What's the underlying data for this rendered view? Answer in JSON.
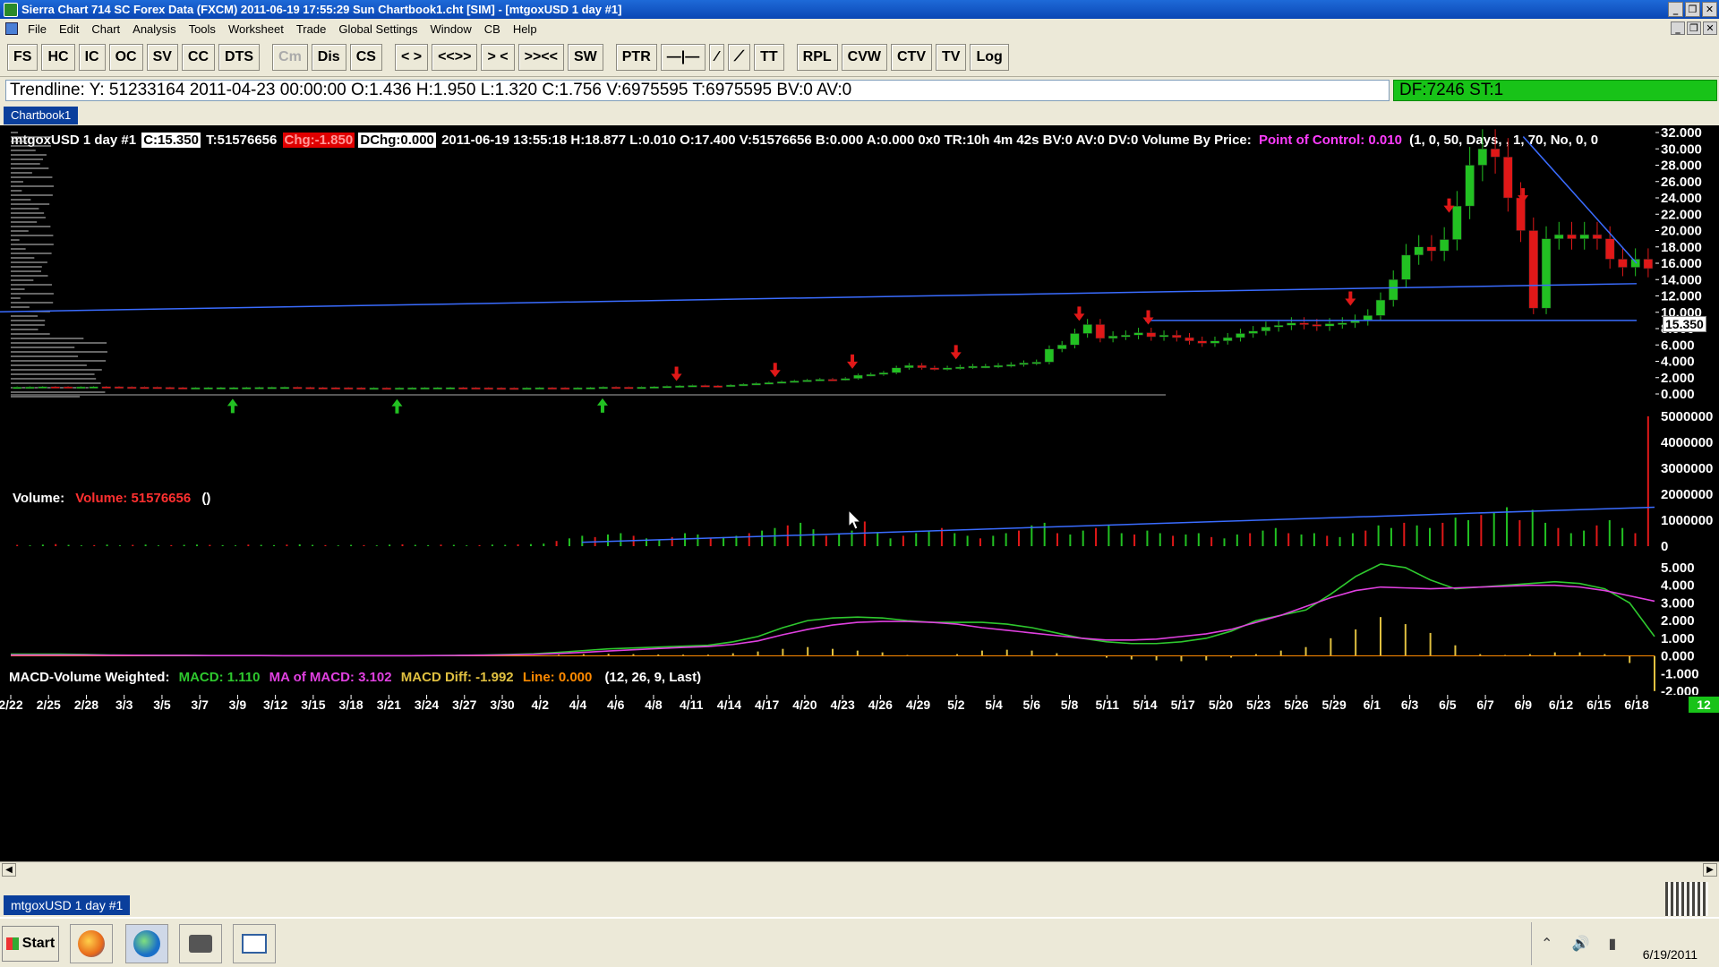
{
  "window": {
    "title": "Sierra Chart 714 SC Forex Data (FXCM) 2011-06-19  17:55:29  Sun   Chartbook1.cht [SIM] - [mtgoxUSD  1 day  #1]",
    "controls": [
      "_",
      "❐",
      "✕"
    ]
  },
  "menu": [
    "File",
    "Edit",
    "Chart",
    "Analysis",
    "Tools",
    "Worksheet",
    "Trade",
    "Global Settings",
    "Window",
    "CB",
    "Help"
  ],
  "toolbar": {
    "buttons": [
      {
        "label": "FS",
        "enabled": true
      },
      {
        "label": "HC",
        "enabled": true
      },
      {
        "label": "IC",
        "enabled": true
      },
      {
        "label": "OC",
        "enabled": true
      },
      {
        "label": "SV",
        "enabled": true
      },
      {
        "label": "CC",
        "enabled": true
      },
      {
        "label": "DTS",
        "enabled": true
      },
      {
        "label": "Cm",
        "enabled": false
      },
      {
        "label": "Dis",
        "enabled": true
      },
      {
        "label": "CS",
        "enabled": true
      },
      {
        "label": "< >",
        "enabled": true
      },
      {
        "label": "<<>>",
        "enabled": true
      },
      {
        "label": "> <",
        "enabled": true
      },
      {
        "label": ">><<",
        "enabled": true
      },
      {
        "label": "SW",
        "enabled": true
      },
      {
        "label": "PTR",
        "enabled": true
      },
      {
        "label": "—|—",
        "enabled": true
      },
      {
        "label": "⁄",
        "enabled": true
      },
      {
        "label": "⟋",
        "enabled": true
      },
      {
        "label": "TT",
        "enabled": true
      },
      {
        "label": "RPL",
        "enabled": true
      },
      {
        "label": "CVW",
        "enabled": true
      },
      {
        "label": "CTV",
        "enabled": true
      },
      {
        "label": "TV",
        "enabled": true
      },
      {
        "label": "Log",
        "enabled": true
      }
    ]
  },
  "infobar": {
    "trendline": "Trendline: Y: 51233164  2011-04-23  00:00:00  O:1.436  H:1.950  L:1.320  C:1.756  V:6975595  T:6975595  BV:0  AV:0",
    "df": "DF:7246  ST:1"
  },
  "chartbook_tab": "Chartbook1",
  "chart_header": {
    "symbol": "mtgoxUSD  1 day   #1",
    "close": "C:15.350",
    "ticks": "T:51576656",
    "chg": "Chg:-1.850",
    "dchg": "DChg:0.000",
    "detail": "2011-06-19 13:55:18 H:18.877 L:0.010 O:17.400 V:51576656 B:0.000 A:0.000 0x0 TR:10h 4m 42s BV:0 AV:0 DV:0 Volume By Price:",
    "poc": "Point of Control: 0.010",
    "params": "(1, 0, 50, Days, , 1, 70, No, 0, 0"
  },
  "price_tag": "15.350",
  "volume_label": {
    "name": "Volume:",
    "value": "Volume: 51576656",
    "extra": "()"
  },
  "macd_label": {
    "name": "MACD-Volume Weighted:",
    "macd": "MACD: 1.110",
    "ma": "MA of MACD: 3.102",
    "diff": "MACD Diff: -1.992",
    "line": "Line: 0.000",
    "params": "(12, 26, 9, Last)"
  },
  "colors": {
    "up": "#22c122",
    "down": "#e01818",
    "trend": "#3a6cff",
    "macd": "#2ec82e",
    "ma": "#e040e0",
    "diff": "#e0c040",
    "line": "#ff8a00"
  },
  "chart_data": [
    {
      "type": "candlestick",
      "title": "mtgoxUSD 1 day",
      "x_ticks": [
        "2/22",
        "2/25",
        "2/28",
        "3/3",
        "3/5",
        "3/7",
        "3/9",
        "3/12",
        "3/15",
        "3/18",
        "3/21",
        "3/24",
        "3/27",
        "3/30",
        "4/2",
        "4/4",
        "4/6",
        "4/8",
        "4/11",
        "4/14",
        "4/17",
        "4/20",
        "4/23",
        "4/26",
        "4/29",
        "5/2",
        "5/4",
        "5/6",
        "5/8",
        "5/11",
        "5/14",
        "5/17",
        "5/20",
        "5/23",
        "5/26",
        "5/29",
        "6/1",
        "6/3",
        "6/5",
        "6/7",
        "6/9",
        "6/12",
        "6/15",
        "6/18"
      ],
      "y_ticks": [
        "32.000",
        "30.000",
        "28.000",
        "26.000",
        "24.000",
        "22.000",
        "20.000",
        "18.000",
        "16.000",
        "14.000",
        "12.000",
        "10.000",
        "8.000",
        "6.000",
        "4.000",
        "2.000",
        "0.000"
      ],
      "ylim": [
        0,
        32
      ],
      "closes": [
        0.85,
        0.87,
        0.9,
        0.89,
        0.86,
        0.88,
        0.9,
        0.89,
        0.87,
        0.85,
        0.84,
        0.82,
        0.8,
        0.78,
        0.78,
        0.79,
        0.8,
        0.8,
        0.81,
        0.82,
        0.83,
        0.84,
        0.82,
        0.8,
        0.79,
        0.78,
        0.77,
        0.76,
        0.76,
        0.75,
        0.76,
        0.77,
        0.78,
        0.79,
        0.8,
        0.78,
        0.77,
        0.76,
        0.75,
        0.74,
        0.76,
        0.78,
        0.77,
        0.75,
        0.77,
        0.8,
        0.86,
        0.84,
        0.82,
        0.85,
        0.9,
        0.95,
        1.0,
        1.05,
        1.02,
        0.98,
        1.1,
        1.2,
        1.3,
        1.4,
        1.5,
        1.6,
        1.7,
        1.8,
        1.75,
        1.9,
        2.3,
        2.4,
        2.6,
        3.2,
        3.5,
        3.2,
        3.1,
        3.2,
        3.3,
        3.4,
        3.4,
        3.5,
        3.6,
        3.8,
        3.9,
        5.5,
        6.0,
        7.4,
        8.5,
        6.8,
        7.1,
        7.2,
        7.5,
        7.0,
        7.2,
        6.9,
        6.5,
        6.2,
        6.5,
        6.9,
        7.4,
        7.7,
        8.2,
        8.4,
        8.7,
        8.5,
        8.3,
        8.6,
        8.7,
        9.0,
        9.6,
        11.5,
        14.0,
        17.0,
        18.0,
        17.5,
        18.9,
        23.0,
        28.0,
        30.0,
        29.0,
        24.0,
        20.0,
        10.5,
        19.0,
        19.5,
        19.0,
        19.5,
        19.0,
        16.5,
        15.5,
        16.5,
        15.35
      ],
      "annotations": [
        {
          "type": "trendline",
          "from": [
            "5/14",
            9.0
          ],
          "to": [
            "6/18",
            9.0
          ]
        },
        {
          "type": "trendline",
          "from": [
            "6/9",
            31.5
          ],
          "to": [
            "6/18",
            16.0
          ]
        },
        {
          "type": "trendline",
          "from": [
            "6/11",
            10.0
          ],
          "to": [
            "6/18",
            13.5
          ]
        }
      ]
    },
    {
      "type": "bar",
      "title": "Volume",
      "y_ticks": [
        "5000000",
        "4000000",
        "3000000",
        "2000000",
        "1000000",
        "0"
      ],
      "ylim": [
        0,
        5000000
      ],
      "values": [
        50000,
        30000,
        60000,
        80000,
        50000,
        30000,
        40000,
        60000,
        30000,
        50000,
        60000,
        30000,
        40000,
        50000,
        60000,
        50000,
        40000,
        30000,
        60000,
        50000,
        40000,
        60000,
        70000,
        50000,
        40000,
        30000,
        50000,
        40000,
        30000,
        60000,
        70000,
        50000,
        40000,
        60000,
        50000,
        30000,
        40000,
        60000,
        50000,
        70000,
        80000,
        100000,
        200000,
        300000,
        400000,
        350000,
        450000,
        500000,
        400000,
        300000,
        250000,
        350000,
        500000,
        450000,
        300000,
        350000,
        400000,
        500000,
        600000,
        700000,
        800000,
        900000,
        650000,
        400000,
        500000,
        600000,
        950000,
        500000,
        300000,
        400000,
        500000,
        600000,
        700000,
        500000,
        400000,
        300000,
        400000,
        500000,
        600000,
        800000,
        900000,
        500000,
        450000,
        600000,
        700000,
        800000,
        500000,
        450000,
        600000,
        500000,
        400000,
        450000,
        500000,
        350000,
        300000,
        450000,
        500000,
        600000,
        700000,
        500000,
        450000,
        500000,
        400000,
        350000,
        500000,
        600000,
        800000,
        700000,
        900000,
        800000,
        700000,
        900000,
        1100000,
        1000000,
        1200000,
        1300000,
        1500000,
        1000000,
        1400000,
        900000,
        700000,
        500000,
        600000,
        800000,
        1000000,
        700000,
        500000,
        5000000
      ]
    },
    {
      "type": "line",
      "title": "MACD-Volume Weighted",
      "y_ticks": [
        "5.000",
        "4.000",
        "3.000",
        "2.000",
        "1.000",
        "0.000",
        "-1.000",
        "-2.000"
      ],
      "ylim": [
        -2,
        5.2
      ],
      "series": [
        {
          "name": "MACD",
          "values": [
            0.1,
            0.1,
            0.1,
            0.08,
            0.05,
            0.04,
            0.03,
            0.03,
            0.02,
            0.02,
            0.02,
            0.01,
            0.01,
            0.01,
            0.01,
            0.01,
            0.01,
            0.02,
            0.03,
            0.05,
            0.08,
            0.12,
            0.2,
            0.3,
            0.4,
            0.45,
            0.5,
            0.55,
            0.6,
            0.8,
            1.1,
            1.6,
            2.0,
            2.15,
            2.2,
            2.15,
            2.0,
            1.9,
            1.9,
            1.9,
            1.8,
            1.6,
            1.3,
            1.0,
            0.8,
            0.7,
            0.7,
            0.8,
            1.0,
            1.4,
            2.0,
            2.3,
            2.6,
            3.5,
            4.5,
            5.2,
            5.0,
            4.3,
            3.8,
            3.9,
            4.0,
            4.1,
            4.2,
            4.1,
            3.8,
            3.0,
            1.1
          ]
        },
        {
          "name": "MA of MACD",
          "values": [
            0.05,
            0.05,
            0.05,
            0.05,
            0.04,
            0.04,
            0.03,
            0.03,
            0.02,
            0.02,
            0.02,
            0.01,
            0.01,
            0.01,
            0.01,
            0.01,
            0.01,
            0.02,
            0.03,
            0.04,
            0.06,
            0.09,
            0.14,
            0.2,
            0.28,
            0.35,
            0.42,
            0.48,
            0.53,
            0.65,
            0.85,
            1.2,
            1.5,
            1.75,
            1.9,
            1.95,
            1.95,
            1.9,
            1.8,
            1.6,
            1.45,
            1.3,
            1.15,
            1.0,
            0.9,
            0.9,
            0.95,
            1.1,
            1.25,
            1.5,
            1.9,
            2.3,
            2.8,
            3.3,
            3.7,
            3.9,
            3.85,
            3.8,
            3.85,
            3.9,
            3.95,
            4.0,
            4.0,
            3.9,
            3.7,
            3.4,
            3.1
          ]
        },
        {
          "name": "MACD Diff",
          "values": [
            0,
            0,
            0,
            0,
            0,
            0,
            0,
            0,
            0,
            0,
            0,
            0,
            0,
            0,
            0,
            0,
            0,
            0,
            0,
            0,
            0.02,
            0.03,
            0.06,
            0.1,
            0.12,
            0.1,
            0.08,
            0.07,
            0.07,
            0.15,
            0.25,
            0.4,
            0.5,
            0.4,
            0.3,
            0.2,
            0.05,
            0,
            0.1,
            0.3,
            0.35,
            0.3,
            0.15,
            0,
            -0.1,
            -0.2,
            -0.25,
            -0.3,
            -0.25,
            -0.1,
            0.1,
            0.3,
            0.5,
            1.0,
            1.5,
            2.2,
            1.8,
            1.3,
            0.6,
            0.1,
            0.05,
            0.1,
            0.2,
            0.2,
            0.1,
            -0.4,
            -1.99
          ]
        }
      ]
    }
  ],
  "chartlist_tab": "mtgoxUSD  1 day   #1",
  "taskbar": {
    "start": "Start",
    "date": "6/19/2011"
  },
  "status_badge": "12"
}
